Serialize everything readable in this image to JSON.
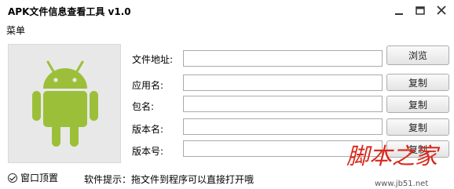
{
  "window": {
    "title": "APK文件信息查看工具 v1.0"
  },
  "menu": {
    "label": "菜单"
  },
  "colors": {
    "android_green": "#9cbf3a",
    "logo_background": "#e8e8e8",
    "watermark_red": "#d9291c"
  },
  "icons": {
    "app_logo": "android-robot-icon",
    "minimize": "minimize-icon",
    "maximize": "maximize-icon",
    "close": "close-icon"
  },
  "fields": {
    "file_path": {
      "label": "文件地址:",
      "value": "",
      "button": "浏览"
    },
    "app_name": {
      "label": "应用名:",
      "value": "",
      "button": "复制"
    },
    "package_name": {
      "label": "包名:",
      "value": "",
      "button": "复制"
    },
    "version_name": {
      "label": "版本名:",
      "value": "",
      "button": "复制"
    },
    "version_code": {
      "label": "版本号:",
      "value": "",
      "button": "复制"
    }
  },
  "footer": {
    "checkbox_label": "窗口顶置",
    "checkbox_checked": true,
    "tip": "软件提示：拖文件到程序可以直接打开哦"
  },
  "watermark": {
    "text": "脚本之家",
    "url_text": "www.jb51.net"
  }
}
